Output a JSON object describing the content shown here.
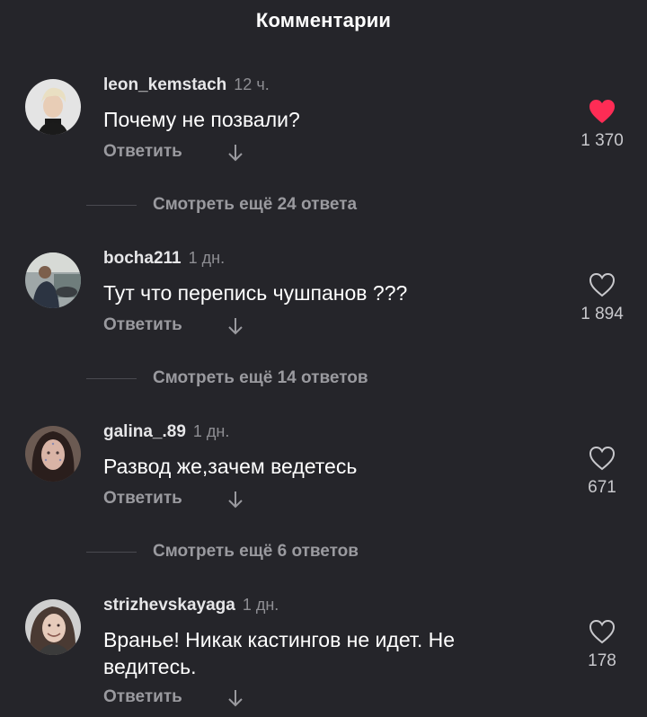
{
  "header": {
    "title": "Комментарии"
  },
  "comments": [
    {
      "username": "leon_kemstach",
      "time": "12 ч.",
      "text": "Почему не позвали?",
      "reply_label": "Ответить",
      "likes": "1 370",
      "liked": true,
      "more_replies": "Смотреть ещё 24 ответа"
    },
    {
      "username": "bocha211",
      "time": "1 дн.",
      "text": "Тут что перепись чушпанов ???",
      "reply_label": "Ответить",
      "likes": "1 894",
      "liked": false,
      "more_replies": "Смотреть ещё 14 ответов"
    },
    {
      "username": "galina_.89",
      "time": "1 дн.",
      "text": "Развод же,зачем ведетесь",
      "reply_label": "Ответить",
      "likes": "671",
      "liked": false,
      "more_replies": "Смотреть ещё 6 ответов"
    },
    {
      "username": "strizhevskayaga",
      "time": "1 дн.",
      "text": "Вранье! Никак кастингов не идет. Не ведитесь.",
      "reply_label": "Ответить",
      "likes": "178",
      "liked": false
    }
  ],
  "colors": {
    "background": "#25252a",
    "like_active": "#fe2c55",
    "secondary_text": "#9a9a9f"
  }
}
